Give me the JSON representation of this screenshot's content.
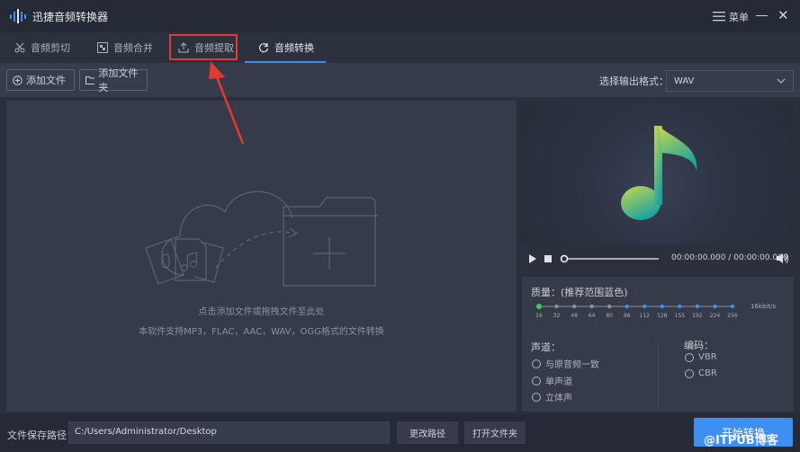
{
  "app": {
    "title": "迅捷音频转换器",
    "menu_label": "菜单"
  },
  "tabs": [
    {
      "label": "音频剪切",
      "icon": "scissors-icon"
    },
    {
      "label": "音频合并",
      "icon": "merge-icon"
    },
    {
      "label": "音频提取",
      "icon": "upload-icon"
    },
    {
      "label": "音频转换",
      "icon": "refresh-icon",
      "active": true
    }
  ],
  "toolbar": {
    "add_file": "添加文件",
    "add_folder": "添加文件夹",
    "format_label": "选择输出格式：",
    "format_value": "WAV"
  },
  "dropzone": {
    "hint": "点击添加文件或拖拽文件至此处",
    "formats": "本软件支持MP3，FLAC，AAC，WAV，OGG格式的文件转换"
  },
  "player": {
    "time": "00:00:00.000 / 00:00:00.000"
  },
  "settings": {
    "quality_label": "质量：(推荐范围蓝色)",
    "quality_ticks": [
      "16",
      "32",
      "48",
      "64",
      "80",
      "96",
      "112",
      "128",
      "155",
      "192",
      "224",
      "256"
    ],
    "bitrate": "16kbit/s",
    "channel_label": "声道：",
    "channels": [
      "与原音频一致",
      "单声道",
      "立体声"
    ],
    "encode_label": "编码：",
    "encodings": [
      "VBR",
      "CBR"
    ]
  },
  "footer": {
    "path_label": "文件保存路径：",
    "path_value": "C:/Users/Administrator/Desktop",
    "change_path": "更改路径",
    "open_folder": "打开文件夹",
    "start": "开始转换"
  },
  "watermark": "@ITPUB博客",
  "colors": {
    "accent": "#3d8ef0",
    "highlight": "#e53935",
    "note_gradient": [
      "#c8d84a",
      "#1fa3a0"
    ]
  }
}
